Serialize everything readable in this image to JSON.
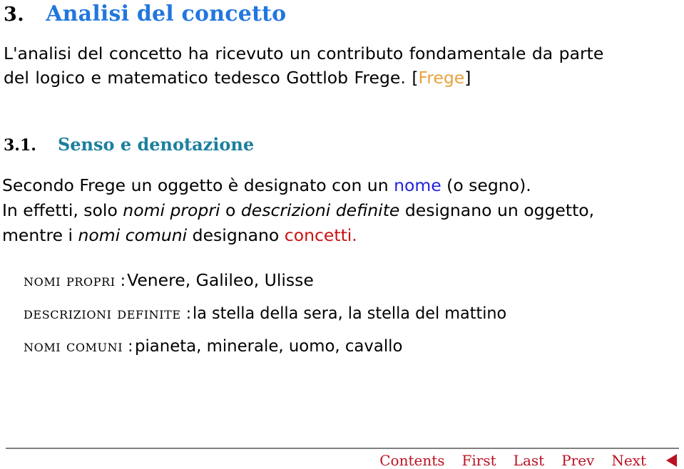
{
  "section": {
    "number": "3.",
    "title": "Analisi del concetto",
    "number_color": "#000000",
    "title_color": "#2277dd"
  },
  "intro": {
    "line1": "L'analisi del concetto ha ricevuto un contributo fondamentale da parte",
    "line2_before_cite": "del logico e matematico tedesco Gottlob Frege.",
    "cite_open": "[",
    "cite_key": "Frege",
    "cite_close": "]",
    "cite_color": "#e8a33d"
  },
  "subsection": {
    "number": "3.1.",
    "title": "Senso e denotazione",
    "title_color": "#1b7f9e"
  },
  "body": {
    "line1_a": "Secondo Frege un oggetto è designato con un ",
    "line1_kw": "nome",
    "line1_b": " (o segno).",
    "line2_a": "In effetti, solo ",
    "line2_it1": "nomi propri",
    "line2_b": " o ",
    "line2_it2": "descrizioni definite",
    "line2_c": " designano un oggetto,",
    "line3_a": "mentre i ",
    "line3_it1": "nomi comuni",
    "line3_b": " designano ",
    "line3_kw": "concetti.",
    "kw_nome_color": "#2222dd",
    "kw_concetti_color": "#cc1111"
  },
  "definitions": {
    "separator": ":",
    "items": [
      {
        "term": "NOMI PROPRI",
        "description": "Venere, Galileo, Ulisse"
      },
      {
        "term": "DESCRIZIONI DEFINITE",
        "description": "la stella della sera, la stella del mattino"
      },
      {
        "term": "NOMI COMUNI",
        "description": "pianeta, minerale, uomo, cavallo"
      }
    ]
  },
  "footer": {
    "links": [
      {
        "label": "Contents"
      },
      {
        "label": "First"
      },
      {
        "label": "Last"
      },
      {
        "label": "Prev"
      },
      {
        "label": "Next"
      }
    ],
    "back_arrow_icon": "left-triangle-icon",
    "link_color": "#bb1122",
    "rule_color": "#808080"
  }
}
